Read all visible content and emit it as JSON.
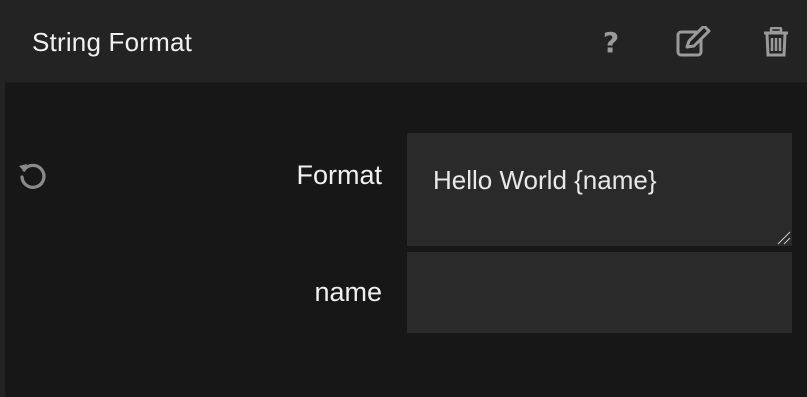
{
  "node": {
    "title": "String Format",
    "icons": {
      "help": "question-mark-icon",
      "edit": "edit-icon",
      "delete": "trash-icon",
      "reset": "reset-icon"
    }
  },
  "fields": {
    "format": {
      "label": "Format",
      "value": "Hello World {name}"
    },
    "name": {
      "label": "name",
      "value": "",
      "placeholder": ""
    }
  },
  "colors": {
    "background": "#171717",
    "header": "#232323",
    "input": "#2a2a2a",
    "text": "#f0f0f0",
    "icon": "#9a9a9a"
  }
}
